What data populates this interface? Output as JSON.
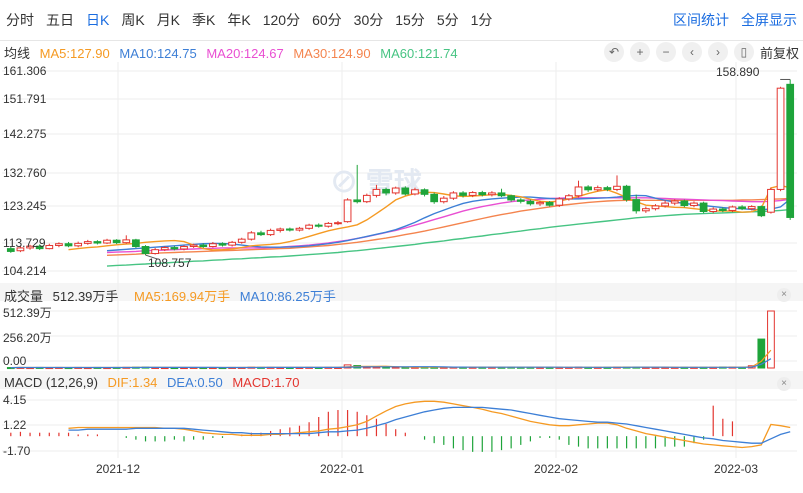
{
  "tabs": [
    "分时",
    "五日",
    "日K",
    "周K",
    "月K",
    "季K",
    "年K",
    "120分",
    "60分",
    "30分",
    "15分",
    "5分",
    "1分"
  ],
  "active_tab": "日K",
  "right_links": [
    "区间统计",
    "全屏显示"
  ],
  "main_info": {
    "label": "均线",
    "ma5": "MA5:127.90",
    "ma10": "MA10:124.75",
    "ma20": "MA20:124.67",
    "ma30": "MA30:124.90",
    "ma60": "MA60:121.74"
  },
  "controls": {
    "adjust": "前复权",
    "icons": [
      "undo-icon",
      "zoom-in-icon",
      "zoom-out-icon",
      "prev-icon",
      "next-icon",
      "candle-type-icon"
    ]
  },
  "colors": {
    "up": "#e3352f",
    "down": "#1ea43a",
    "ma5": "#f59a23",
    "ma10": "#3d7fd6",
    "ma20": "#e94fd2",
    "ma30": "#f4844e",
    "ma60": "#47c483",
    "diff": "#f59a23",
    "dea": "#3d7fd6",
    "macd": "#e3352f",
    "accent": "#1a6ce0"
  },
  "price_axis": [
    "161.306",
    "151.791",
    "142.275",
    "132.760",
    "123.245",
    "113.729",
    "104.214"
  ],
  "price_markers": {
    "high": "158.890",
    "low": "108.757"
  },
  "volume_info": {
    "label": "成交量",
    "total": "512.39万手",
    "ma5": "MA5:169.94万手",
    "ma10": "MA10:86.25万手"
  },
  "volume_axis": [
    "512.39万",
    "256.20万",
    "0.00"
  ],
  "macd_info": {
    "label": "MACD (12,26,9)",
    "dif": "DIF:1.34",
    "dea": "DEA:0.50",
    "macd": "MACD:1.70"
  },
  "macd_axis": [
    "4.15",
    "1.22",
    "-1.70"
  ],
  "x_ticks": [
    "2021-12",
    "2022-01",
    "2022-02",
    "2022-03"
  ],
  "chart_data": {
    "type": "candlestick",
    "ylim": [
      104.214,
      161.306
    ],
    "candles": [
      {
        "o": 110.6,
        "c": 109.8,
        "h": 111.2,
        "l": 109.4
      },
      {
        "o": 110.0,
        "c": 110.8,
        "h": 111.4,
        "l": 109.6
      },
      {
        "o": 110.8,
        "c": 111.3,
        "h": 111.7,
        "l": 110.3
      },
      {
        "o": 111.3,
        "c": 110.6,
        "h": 111.8,
        "l": 110.2
      },
      {
        "o": 110.6,
        "c": 111.5,
        "h": 112.0,
        "l": 110.4
      },
      {
        "o": 111.5,
        "c": 112.0,
        "h": 112.4,
        "l": 111.0
      },
      {
        "o": 112.0,
        "c": 111.4,
        "h": 112.5,
        "l": 111.0
      },
      {
        "o": 111.4,
        "c": 112.1,
        "h": 112.6,
        "l": 111.0
      },
      {
        "o": 112.1,
        "c": 112.6,
        "h": 113.1,
        "l": 111.7
      },
      {
        "o": 112.6,
        "c": 112.2,
        "h": 113.0,
        "l": 111.8
      },
      {
        "o": 112.2,
        "c": 113.0,
        "h": 113.4,
        "l": 111.9
      },
      {
        "o": 113.0,
        "c": 112.3,
        "h": 113.3,
        "l": 111.9
      },
      {
        "o": 112.3,
        "c": 113.1,
        "h": 114.4,
        "l": 112.0
      },
      {
        "o": 113.1,
        "c": 111.2,
        "h": 113.4,
        "l": 110.8
      },
      {
        "o": 111.2,
        "c": 109.2,
        "h": 111.6,
        "l": 108.757
      },
      {
        "o": 109.2,
        "c": 110.3,
        "h": 110.8,
        "l": 108.9
      },
      {
        "o": 110.3,
        "c": 110.9,
        "h": 111.3,
        "l": 109.9
      },
      {
        "o": 110.9,
        "c": 110.5,
        "h": 111.4,
        "l": 110.1
      },
      {
        "o": 110.5,
        "c": 111.2,
        "h": 111.6,
        "l": 110.1
      },
      {
        "o": 111.2,
        "c": 111.6,
        "h": 112.0,
        "l": 110.8
      },
      {
        "o": 111.6,
        "c": 111.2,
        "h": 112.1,
        "l": 110.8
      },
      {
        "o": 111.2,
        "c": 112.0,
        "h": 112.5,
        "l": 110.9
      },
      {
        "o": 112.0,
        "c": 111.6,
        "h": 112.4,
        "l": 111.2
      },
      {
        "o": 111.6,
        "c": 112.4,
        "h": 112.8,
        "l": 111.2
      },
      {
        "o": 112.4,
        "c": 113.3,
        "h": 113.7,
        "l": 112.0
      },
      {
        "o": 113.3,
        "c": 115.1,
        "h": 115.6,
        "l": 112.9
      },
      {
        "o": 115.1,
        "c": 114.6,
        "h": 115.7,
        "l": 114.2
      },
      {
        "o": 114.6,
        "c": 115.8,
        "h": 116.3,
        "l": 114.2
      },
      {
        "o": 115.8,
        "c": 116.2,
        "h": 116.6,
        "l": 115.2
      },
      {
        "o": 116.2,
        "c": 115.9,
        "h": 116.6,
        "l": 115.5
      },
      {
        "o": 115.9,
        "c": 116.4,
        "h": 116.8,
        "l": 115.5
      },
      {
        "o": 116.4,
        "c": 117.3,
        "h": 117.7,
        "l": 116.0
      },
      {
        "o": 117.3,
        "c": 117.0,
        "h": 117.8,
        "l": 116.6
      },
      {
        "o": 117.0,
        "c": 117.8,
        "h": 118.2,
        "l": 116.6
      },
      {
        "o": 117.8,
        "c": 118.0,
        "h": 118.5,
        "l": 117.3
      },
      {
        "o": 118.3,
        "c": 124.5,
        "h": 125.0,
        "l": 118.0
      },
      {
        "o": 124.5,
        "c": 124.0,
        "h": 134.5,
        "l": 123.5
      },
      {
        "o": 124.0,
        "c": 125.8,
        "h": 126.3,
        "l": 123.6
      },
      {
        "o": 125.8,
        "c": 127.5,
        "h": 128.8,
        "l": 125.2
      },
      {
        "o": 127.5,
        "c": 126.5,
        "h": 128.0,
        "l": 125.8
      },
      {
        "o": 126.5,
        "c": 127.9,
        "h": 128.3,
        "l": 126.0
      },
      {
        "o": 127.9,
        "c": 126.2,
        "h": 128.4,
        "l": 125.8
      },
      {
        "o": 126.2,
        "c": 127.4,
        "h": 128.0,
        "l": 125.8
      },
      {
        "o": 127.4,
        "c": 126.1,
        "h": 127.8,
        "l": 125.5
      },
      {
        "o": 126.1,
        "c": 124.0,
        "h": 126.6,
        "l": 123.4
      },
      {
        "o": 124.0,
        "c": 125.0,
        "h": 125.6,
        "l": 123.5
      },
      {
        "o": 125.0,
        "c": 126.5,
        "h": 127.0,
        "l": 124.5
      },
      {
        "o": 126.5,
        "c": 125.8,
        "h": 127.0,
        "l": 125.2
      },
      {
        "o": 125.8,
        "c": 126.6,
        "h": 127.0,
        "l": 125.3
      },
      {
        "o": 126.6,
        "c": 126.0,
        "h": 127.1,
        "l": 125.5
      },
      {
        "o": 126.0,
        "c": 126.5,
        "h": 127.0,
        "l": 125.5
      },
      {
        "o": 126.5,
        "c": 125.7,
        "h": 127.7,
        "l": 125.3
      },
      {
        "o": 125.7,
        "c": 124.5,
        "h": 126.0,
        "l": 124.0
      },
      {
        "o": 124.5,
        "c": 124.1,
        "h": 125.0,
        "l": 123.5
      },
      {
        "o": 124.1,
        "c": 123.4,
        "h": 124.6,
        "l": 122.9
      },
      {
        "o": 123.4,
        "c": 123.8,
        "h": 124.3,
        "l": 122.8
      },
      {
        "o": 123.8,
        "c": 123.0,
        "h": 124.2,
        "l": 122.6
      },
      {
        "o": 123.0,
        "c": 124.8,
        "h": 125.3,
        "l": 122.5
      },
      {
        "o": 124.8,
        "c": 125.7,
        "h": 126.2,
        "l": 124.3
      },
      {
        "o": 125.7,
        "c": 128.2,
        "h": 130.0,
        "l": 125.2
      },
      {
        "o": 128.2,
        "c": 127.4,
        "h": 128.7,
        "l": 126.8
      },
      {
        "o": 127.4,
        "c": 128.0,
        "h": 128.6,
        "l": 126.9
      },
      {
        "o": 128.0,
        "c": 127.5,
        "h": 128.5,
        "l": 127.0
      },
      {
        "o": 127.5,
        "c": 128.4,
        "h": 131.5,
        "l": 127.0
      },
      {
        "o": 128.4,
        "c": 124.6,
        "h": 128.8,
        "l": 124.0
      },
      {
        "o": 124.6,
        "c": 121.4,
        "h": 126.0,
        "l": 120.6
      },
      {
        "o": 121.4,
        "c": 122.0,
        "h": 122.6,
        "l": 120.8
      },
      {
        "o": 122.0,
        "c": 122.8,
        "h": 123.3,
        "l": 121.5
      },
      {
        "o": 122.8,
        "c": 123.6,
        "h": 124.4,
        "l": 122.3
      },
      {
        "o": 123.6,
        "c": 124.2,
        "h": 124.7,
        "l": 123.0
      },
      {
        "o": 124.2,
        "c": 122.9,
        "h": 124.6,
        "l": 122.4
      },
      {
        "o": 122.9,
        "c": 123.6,
        "h": 124.1,
        "l": 122.4
      },
      {
        "o": 123.6,
        "c": 121.2,
        "h": 124.0,
        "l": 120.7
      },
      {
        "o": 121.2,
        "c": 121.9,
        "h": 122.4,
        "l": 120.7
      },
      {
        "o": 121.9,
        "c": 121.5,
        "h": 122.4,
        "l": 121.0
      },
      {
        "o": 121.5,
        "c": 122.5,
        "h": 122.9,
        "l": 121.0
      },
      {
        "o": 122.5,
        "c": 122.0,
        "h": 123.0,
        "l": 121.6
      },
      {
        "o": 122.0,
        "c": 122.6,
        "h": 123.0,
        "l": 121.5
      },
      {
        "o": 122.6,
        "c": 120.0,
        "h": 122.9,
        "l": 119.6
      },
      {
        "o": 121.0,
        "c": 127.5,
        "h": 128.0,
        "l": 120.6
      },
      {
        "o": 127.5,
        "c": 156.4,
        "h": 156.8,
        "l": 127.0
      },
      {
        "o": 157.5,
        "c": 119.5,
        "h": 158.89,
        "l": 118.8
      }
    ],
    "ma": {
      "ma5": [
        110.3,
        110.6,
        110.9,
        111.1,
        111.4,
        111.7,
        111.9,
        112.1,
        112.4,
        112.6,
        112.8,
        112.9,
        112.6,
        111.6,
        110.6,
        110.2,
        110.3,
        110.5,
        110.9,
        111.4,
        111.6,
        111.8,
        112.1,
        112.6,
        113.3,
        114.1,
        114.9,
        115.7,
        116.3,
        116.8,
        117.4,
        118.8,
        120.6,
        122.5,
        124.5,
        125.6,
        126.3,
        126.7,
        126.6,
        126.2,
        125.7,
        125.5,
        125.6,
        125.8,
        126.0,
        126.1,
        125.8,
        125.4,
        124.7,
        124.1,
        123.9,
        124.2,
        124.8,
        125.5,
        126.3,
        127.0,
        127.4,
        126.4,
        125.2,
        124.0,
        123.0,
        122.8,
        122.6,
        122.4,
        122.3,
        122.0,
        121.7,
        121.4,
        121.3,
        121.3,
        121.0,
        121.1,
        122.2,
        127.9,
        128.6,
        128.0
      ],
      "ma10": [
        110.0,
        110.2,
        110.4,
        110.6,
        110.8,
        111.0,
        111.2,
        111.4,
        111.6,
        111.8,
        112.0,
        112.1,
        112.1,
        111.9,
        111.6,
        111.3,
        111.1,
        111.0,
        111.0,
        111.1,
        111.2,
        111.4,
        111.7,
        112.0,
        112.4,
        112.9,
        113.5,
        114.1,
        114.7,
        115.3,
        116.0,
        117.0,
        118.1,
        119.4,
        120.6,
        121.6,
        122.6,
        123.5,
        124.1,
        124.5,
        124.8,
        125.0,
        125.2,
        125.3,
        125.3,
        125.1,
        124.9,
        124.8,
        124.8,
        124.8,
        124.9,
        125.0,
        125.1,
        125.3,
        125.6,
        125.8,
        125.7,
        125.0,
        124.4,
        123.9,
        123.5,
        123.2,
        122.9,
        122.6,
        122.3,
        122.1,
        122.0,
        121.8,
        121.7,
        121.9,
        122.5,
        124.75
      ],
      "ma20": [
        109.5,
        109.6,
        109.7,
        109.8,
        110.0,
        110.1,
        110.2,
        110.3,
        110.4,
        110.5,
        110.6,
        110.7,
        110.8,
        110.8,
        110.8,
        110.8,
        110.8,
        110.9,
        111.0,
        111.2,
        111.4,
        111.6,
        111.9,
        112.2,
        112.6,
        113.0,
        113.5,
        114.0,
        114.6,
        115.2,
        115.8,
        116.5,
        117.3,
        118.1,
        118.9,
        119.7,
        120.5,
        121.3,
        122.0,
        122.6,
        123.1,
        123.6,
        124.0,
        124.3,
        124.5,
        124.7,
        124.9,
        125.0,
        125.1,
        125.1,
        125.1,
        125.1,
        125.1,
        125.1,
        125.1,
        125.1,
        125.1,
        125.0,
        124.9,
        124.8,
        124.7,
        124.6,
        124.5,
        124.4,
        124.3,
        124.2,
        124.1,
        124.0,
        124.0,
        124.1,
        124.3,
        124.67
      ],
      "ma30": [
        108.7,
        108.8,
        108.9,
        109.0,
        109.2,
        109.3,
        109.4,
        109.5,
        109.6,
        109.7,
        109.8,
        109.9,
        110.0,
        110.1,
        110.2,
        110.3,
        110.4,
        110.5,
        110.6,
        110.7,
        110.9,
        111.1,
        111.3,
        111.5,
        111.8,
        112.1,
        112.4,
        112.8,
        113.2,
        113.6,
        114.1,
        114.6,
        115.1,
        115.6,
        116.2,
        116.8,
        117.4,
        118.0,
        118.6,
        119.2,
        119.8,
        120.3,
        120.8,
        121.3,
        121.7,
        122.1,
        122.5,
        122.9,
        123.2,
        123.5,
        123.8,
        124.0,
        124.2,
        124.3,
        124.4,
        124.4,
        124.4,
        124.4,
        124.4,
        124.4,
        124.4,
        124.4,
        124.4,
        124.4,
        124.4,
        124.4,
        124.5,
        124.5,
        124.6,
        124.7,
        124.8,
        124.9
      ],
      "ma60": [
        105.6,
        105.8,
        105.9,
        106.1,
        106.2,
        106.4,
        106.5,
        106.7,
        106.8,
        107.0,
        107.1,
        107.3,
        107.4,
        107.6,
        107.7,
        107.9,
        108.0,
        108.2,
        108.3,
        108.5,
        108.7,
        108.9,
        109.1,
        109.3,
        109.5,
        109.8,
        110.0,
        110.3,
        110.6,
        110.9,
        111.2,
        111.5,
        111.8,
        112.2,
        112.5,
        112.8,
        113.2,
        113.5,
        113.9,
        114.2,
        114.6,
        114.9,
        115.3,
        115.6,
        116.0,
        116.3,
        116.7,
        117.0,
        117.3,
        117.6,
        117.9,
        118.2,
        118.5,
        118.8,
        119.1,
        119.4,
        119.6,
        119.8,
        120.0,
        120.2,
        120.4,
        120.5,
        120.6,
        120.7,
        120.8,
        120.9,
        121.0,
        121.1,
        121.2,
        121.3,
        121.5,
        121.74
      ]
    },
    "volume": {
      "ylim": [
        0,
        512.39
      ],
      "values": [
        4,
        5,
        4,
        5,
        4,
        5,
        4,
        5,
        4,
        5,
        4,
        5,
        6,
        7,
        8,
        5,
        4,
        4,
        4,
        5,
        4,
        4,
        4,
        5,
        5,
        7,
        6,
        6,
        5,
        5,
        5,
        6,
        5,
        6,
        5,
        28,
        22,
        12,
        10,
        8,
        8,
        7,
        7,
        8,
        7,
        7,
        8,
        7,
        7,
        7,
        7,
        7,
        8,
        7,
        7,
        6,
        6,
        6,
        6,
        8,
        6,
        6,
        6,
        8,
        8,
        8,
        6,
        6,
        6,
        6,
        6,
        6,
        6,
        6,
        8,
        8,
        6,
        20,
        260,
        512.39
      ]
    },
    "macd": {
      "ylim": [
        -2.0,
        4.3
      ],
      "dif": [
        0.9,
        1.0,
        1.0,
        1.0,
        1.0,
        1.0,
        1.0,
        1.0,
        1.0,
        1.0,
        0.9,
        0.9,
        0.8,
        0.6,
        0.4,
        0.3,
        0.2,
        0.2,
        0.1,
        0.1,
        0.1,
        0.2,
        0.2,
        0.3,
        0.4,
        0.5,
        0.6,
        0.8,
        0.9,
        1.1,
        1.3,
        1.7,
        2.3,
        2.9,
        3.4,
        3.7,
        3.9,
        4.0,
        4.0,
        3.9,
        3.7,
        3.5,
        3.3,
        3.1,
        2.8,
        2.6,
        2.3,
        2.0,
        1.7,
        1.5,
        1.3,
        1.2,
        1.2,
        1.3,
        1.4,
        1.5,
        1.5,
        1.3,
        0.9,
        0.6,
        0.3,
        0.1,
        -0.1,
        -0.3,
        -0.5,
        -0.7,
        -0.9,
        -1.0,
        -1.1,
        -1.2,
        -1.3,
        -1.2,
        -1.0,
        1.34,
        1.2,
        1.0
      ],
      "dea": [
        0.7,
        0.7,
        0.8,
        0.8,
        0.8,
        0.8,
        0.8,
        0.9,
        0.9,
        0.9,
        0.9,
        0.9,
        0.9,
        0.8,
        0.7,
        0.6,
        0.5,
        0.4,
        0.4,
        0.3,
        0.3,
        0.3,
        0.3,
        0.3,
        0.3,
        0.3,
        0.4,
        0.5,
        0.5,
        0.6,
        0.7,
        0.9,
        1.2,
        1.5,
        1.9,
        2.2,
        2.5,
        2.8,
        3.0,
        3.2,
        3.3,
        3.3,
        3.3,
        3.3,
        3.2,
        3.1,
        3.0,
        2.8,
        2.6,
        2.4,
        2.2,
        2.0,
        1.9,
        1.8,
        1.7,
        1.6,
        1.6,
        1.5,
        1.4,
        1.2,
        1.0,
        0.8,
        0.6,
        0.4,
        0.2,
        0.0,
        -0.2,
        -0.3,
        -0.5,
        -0.6,
        -0.7,
        -0.8,
        -0.8,
        -0.3,
        0.2,
        0.5
      ],
      "hist": [
        0.4,
        0.5,
        0.4,
        0.4,
        0.4,
        0.4,
        0.4,
        0.2,
        0.2,
        0.2,
        0.0,
        0.0,
        -0.2,
        -0.4,
        -0.6,
        -0.6,
        -0.6,
        -0.4,
        -0.6,
        -0.4,
        -0.4,
        -0.2,
        -0.2,
        0.0,
        0.2,
        0.4,
        0.4,
        0.6,
        0.8,
        1.0,
        1.2,
        1.6,
        2.2,
        2.8,
        3.0,
        3.0,
        2.8,
        2.4,
        2.0,
        1.4,
        0.8,
        0.4,
        0.0,
        -0.4,
        -0.8,
        -1.0,
        -1.4,
        -1.6,
        -1.8,
        -1.8,
        -1.8,
        -1.6,
        -1.4,
        -1.0,
        -0.6,
        -0.2,
        -0.2,
        -0.4,
        -1.0,
        -1.2,
        -1.4,
        -1.4,
        -1.4,
        -1.4,
        -1.4,
        -1.4,
        -1.4,
        -1.4,
        -1.2,
        -1.2,
        -1.2,
        -0.8,
        -0.4,
        3.5,
        2.0,
        1.7
      ]
    }
  }
}
